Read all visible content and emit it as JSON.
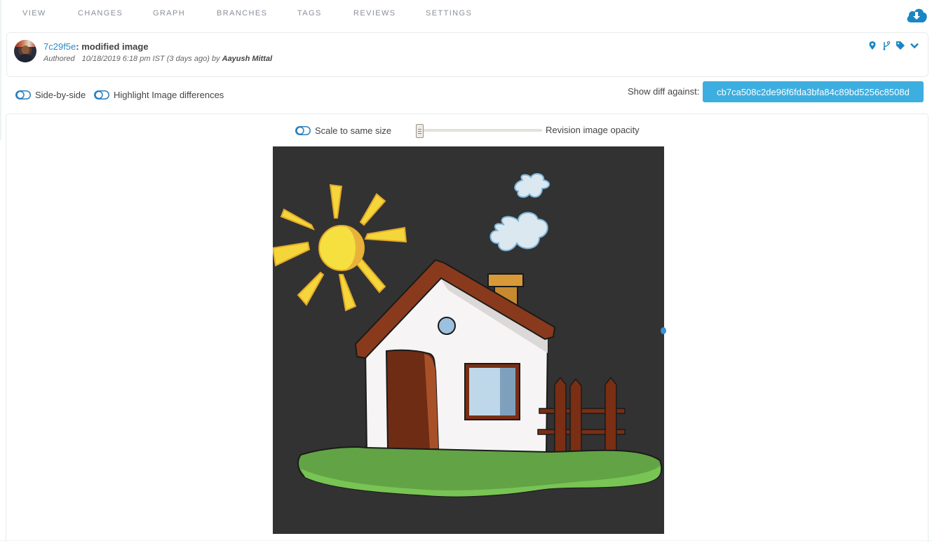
{
  "nav": {
    "items": [
      {
        "label": "VIEW"
      },
      {
        "label": "CHANGES"
      },
      {
        "label": "GRAPH"
      },
      {
        "label": "BRANCHES"
      },
      {
        "label": "TAGS"
      },
      {
        "label": "REVIEWS"
      },
      {
        "label": "SETTINGS"
      }
    ],
    "download_icon": "cloud-download-icon"
  },
  "commit": {
    "hash": "7c29f5e",
    "separator": ": ",
    "message": "modified image",
    "authored_label": "Authored",
    "date": "10/18/2019 6:18 pm IST (3 days ago) by ",
    "author": "Aayush Mittal",
    "actions": [
      "map-marker-icon",
      "branch-icon",
      "tag-icon",
      "chevron-down-icon"
    ]
  },
  "options": {
    "side_by_side": "Side-by-side",
    "highlight": "Highlight Image differences",
    "diff_label": "Show diff against:",
    "diff_commit": "cb7ca508c2de96f6fda3bfa84c89bd5256c8508d"
  },
  "viewer": {
    "scale_label": "Scale to same size",
    "opacity_label": "Revision image opacity",
    "opacity_value": 0,
    "image_description": "Cartoon house with sun, chimney smoke, fence and grass on dark background"
  },
  "colors": {
    "accent": "#2b8cc4",
    "button": "#3daee0",
    "image_bg": "#323232"
  }
}
